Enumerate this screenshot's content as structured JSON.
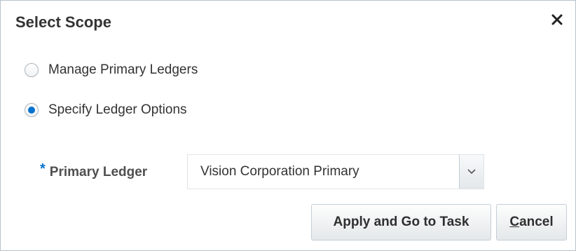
{
  "dialog": {
    "title": "Select Scope",
    "close_glyph": "✕",
    "close_icon": "close-icon"
  },
  "options": [
    {
      "label": "Manage Primary Ledgers",
      "checked": false
    },
    {
      "label": "Specify Ledger Options",
      "checked": true
    }
  ],
  "primary_ledger": {
    "required_marker": "*",
    "label": "Primary Ledger",
    "value": "Vision Corporation Primary",
    "dropdown_icon": "chevron-down-icon"
  },
  "buttons": {
    "apply_label": "Apply and Go to Task",
    "cancel_access_key": "C",
    "cancel_rest": "ancel"
  },
  "colors": {
    "accent": "#0572ce",
    "border": "#b9c3c9"
  }
}
